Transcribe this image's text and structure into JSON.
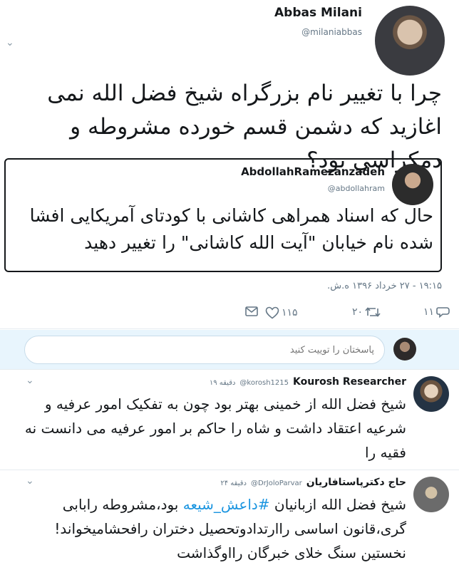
{
  "main_tweet": {
    "author_name": "Abbas Milani",
    "author_handle": "@milaniabbas",
    "text": "چرا با تغيير نام بزرگراه شیخ فضل الله نمی اغازید که دشمن قسم خورده مشروطه و دمکراسي بود؟",
    "timestamp": "۱۹:۱۵ - ۲۷ خرداد ۱۳۹۶ ه.ش.",
    "quoted_tweet": {
      "author_name": "AbdollahRamezanzadeh",
      "author_handle": "@abdollahram",
      "text": "حال که اسناد همراهی کاشانی با کودتای آمریکایی افشا شده نام خیابان \"آیت الله کاشانی\" را تغییر دهید"
    },
    "actions": {
      "reply_count": "۱۱",
      "retweet_count": "۲۰",
      "like_count": "۱۱۵"
    }
  },
  "reply_composer": {
    "placeholder": "پاسختان را توییت کنید"
  },
  "replies": [
    {
      "author_name": "Kourosh Researcher",
      "author_handle": "@korosh1215",
      "time": "۱۹ دقیقه",
      "text": "شیخ فضل الله از خمینی بهتر بود چون به تفکیک امور عرفیه و شرعیه اعتقاد داشت و شاه را حاکم بر امور عرفیه می دانست نه فقیه را"
    },
    {
      "author_name": "حاج دکترپاستافاریان",
      "author_handle": "@DrJoloParvar",
      "time": "۲۴ دقیقه",
      "text_before": "شیخ فضل الله ازبانیان ",
      "hashtag": "#داعش_شیعه",
      "text_after": " بود،مشروطه رابابی گری،قانون اساسی راارتدادوتحصیل دختران رافحشامیخواند!نخستین سنگ خلای خبرگان رااوگذاشت"
    }
  ],
  "colors": {
    "accent": "#1b95e0",
    "secondary_text": "#657786",
    "reply_bar_bg": "#e8f5fd"
  },
  "icons": [
    "chevron-down-icon",
    "envelope-icon",
    "heart-icon",
    "retweet-icon",
    "reply-icon"
  ]
}
